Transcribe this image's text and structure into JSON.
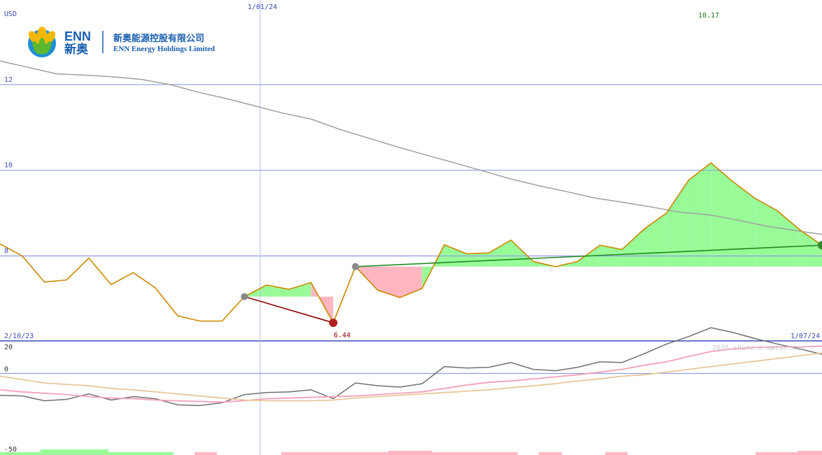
{
  "header": {
    "currency": "USD",
    "date_marker": "1/01/24",
    "high_label": "10.17",
    "low_label": "6.44",
    "start_date": "2/10/23",
    "end_date": "1/07/24",
    "watermark": "2026 share-o-matic.com"
  },
  "logo": {
    "brand": "ENN",
    "brand_cn": "新奥",
    "company_cn": "新奥能源控股有限公司",
    "company_en": "ENN Energy Holdings Limited"
  },
  "colors": {
    "price_line": "#cc8800",
    "avg_line": "#a0a0a0",
    "gain_fill": "#98fb98",
    "loss_fill": "#ffb6c1",
    "trend_up": "#228b22",
    "trend_down": "#8b0000",
    "grid": "#8f9fe6",
    "label_blue": "#3b4bb8"
  },
  "chart_data": [
    {
      "type": "line",
      "title": "",
      "ylabel": "USD",
      "ylim": [
        6.0,
        13.3
      ],
      "y_ticks": [
        8,
        10,
        12
      ],
      "series": [
        {
          "values": [
            8.28,
            8.0,
            7.39,
            7.44,
            7.95,
            7.33,
            7.61,
            7.25,
            6.6,
            6.48,
            6.48,
            7.05,
            7.32,
            7.22,
            7.38,
            6.44,
            7.75,
            7.2,
            7.03,
            7.24,
            8.26,
            8.05,
            8.07,
            8.37,
            7.87,
            7.75,
            7.87,
            8.25,
            8.15,
            8.63,
            9.0,
            9.77,
            10.17,
            9.73,
            9.34,
            9.05,
            8.61,
            8.25
          ]
        },
        {
          "values": [
            12.55,
            12.4,
            12.25,
            12.22,
            12.18,
            12.12,
            12.0,
            11.82,
            11.67,
            11.5,
            11.33,
            11.19,
            10.95,
            10.75,
            10.55,
            10.36,
            10.18,
            9.99,
            9.8,
            9.64,
            9.5,
            9.35,
            9.25,
            9.14,
            9.02,
            8.96,
            8.84,
            8.7,
            8.6,
            8.5
          ]
        }
      ],
      "trend_lines": [
        {
          "from": [
            11,
            7.05
          ],
          "to": [
            15,
            6.44
          ]
        },
        {
          "from": [
            16,
            7.75
          ],
          "to": [
            37,
            8.25
          ]
        }
      ]
    },
    {
      "type": "line",
      "title": "",
      "ylim": [
        -50,
        20
      ],
      "y_ticks": [
        -50,
        0,
        20
      ],
      "series": [
        {
          "values": [
            -16,
            -16.5,
            -20,
            -19,
            -15,
            -19.5,
            -17,
            -18.5,
            -23,
            -23.5,
            -21.5,
            -15.5,
            -14,
            -13.5,
            -12,
            -18.5,
            -7,
            -9,
            -10,
            -7.5,
            5,
            4,
            4.5,
            8,
            3,
            2,
            4.5,
            8.5,
            8,
            14.5,
            21.5,
            27,
            33.5,
            30,
            25.5,
            21.5,
            18,
            14
          ]
        },
        {
          "values": [
            -12,
            -13.5,
            -14.5,
            -15.5,
            -17,
            -18,
            -18.5,
            -19.5,
            -20,
            -20.5,
            -21,
            -20,
            -18.5,
            -18,
            -17.5,
            -17,
            -16.5,
            -15.5,
            -14.5,
            -13.5,
            -11,
            -8.5,
            -6.5,
            -5.5,
            -4,
            -2.5,
            -1,
            1,
            3,
            6,
            8.5,
            12.5,
            16,
            18,
            19,
            19.5,
            19.5,
            20
          ]
        },
        {
          "values": [
            -2,
            -4.5,
            -7,
            -8,
            -9,
            -11,
            -12,
            -13.5,
            -15,
            -16.5,
            -18,
            -19.5,
            -20,
            -20,
            -20,
            -19.5,
            -18,
            -17,
            -16,
            -15,
            -14,
            -13,
            -12,
            -10.5,
            -9,
            -7.5,
            -5.5,
            -4,
            -2,
            -1,
            1,
            3,
            5,
            7,
            9,
            11,
            13,
            15
          ]
        }
      ]
    }
  ]
}
